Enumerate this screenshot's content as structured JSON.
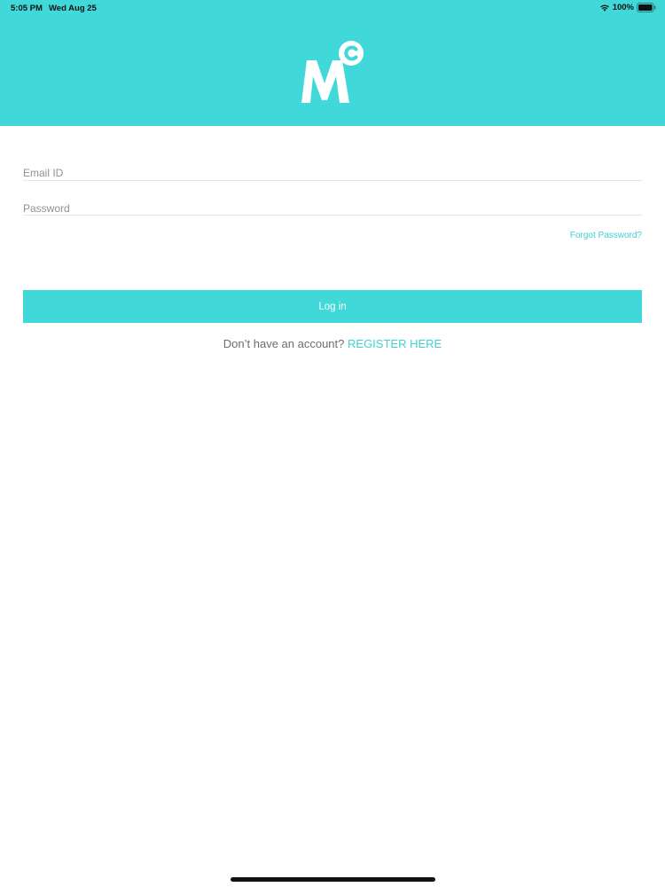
{
  "status_bar": {
    "time": "5:05 PM",
    "date": "Wed Aug 25",
    "battery": "100%"
  },
  "header": {
    "logo_letter": "M",
    "logo_superscript": "c"
  },
  "form": {
    "email_placeholder": "Email ID",
    "password_placeholder": "Password",
    "forgot_label": "Forgot Password?",
    "login_label": "Log in"
  },
  "register": {
    "prompt": "Don’t have an account?",
    "link_label": "REGISTER HERE"
  },
  "colors": {
    "brand": "#40d8d8",
    "link": "#3fd0d4",
    "text_muted": "#6a6d70"
  },
  "icons": [
    "wifi-icon",
    "battery-icon",
    "logo-icon"
  ]
}
